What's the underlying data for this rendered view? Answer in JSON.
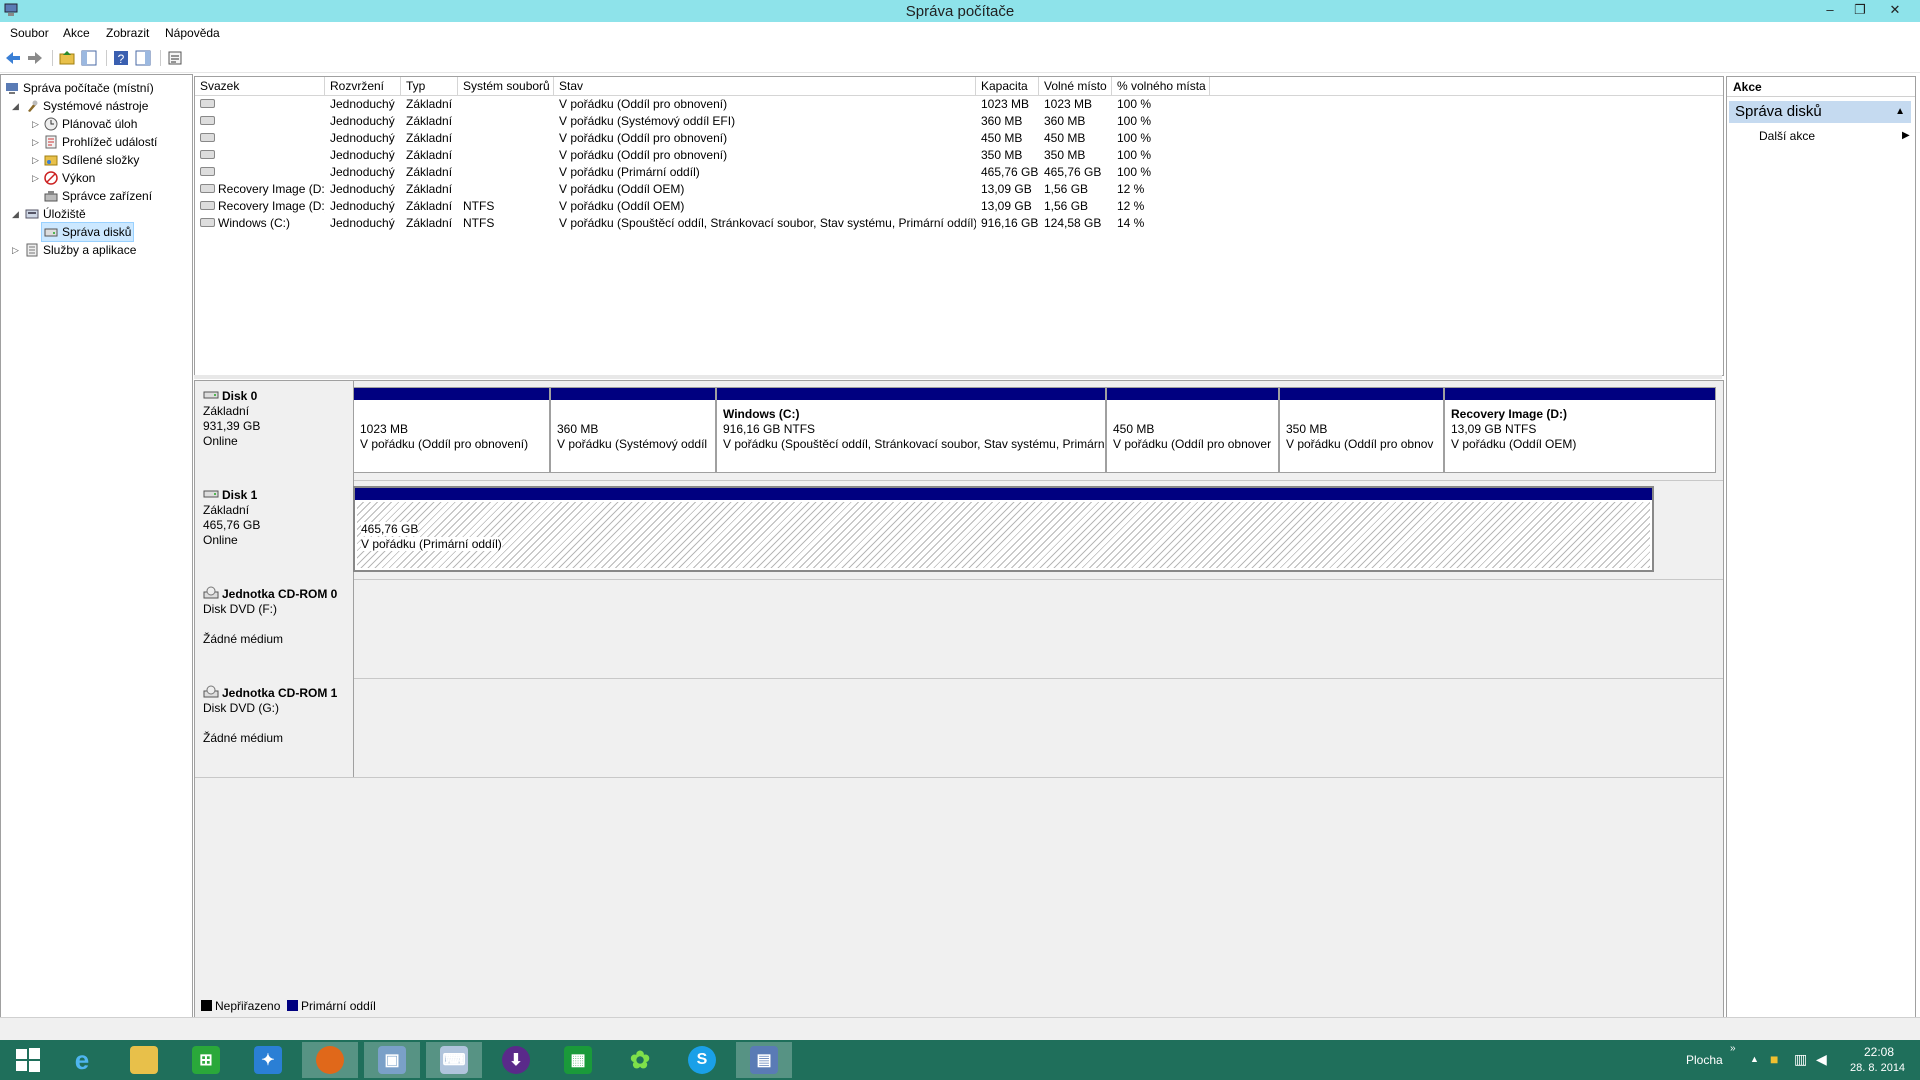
{
  "window": {
    "title": "Správa počítače",
    "minimize": "–",
    "restore": "❐",
    "close": "✕"
  },
  "menu": [
    "Soubor",
    "Akce",
    "Zobrazit",
    "Nápověda"
  ],
  "tree": {
    "root": "Správa počítače (místní)",
    "system_tools": "Systémové nástroje",
    "task_scheduler": "Plánovač úloh",
    "event_viewer": "Prohlížeč událostí",
    "shared_folders": "Sdílené složky",
    "performance": "Výkon",
    "device_manager": "Správce zařízení",
    "storage": "Úložiště",
    "disk_management": "Správa disků",
    "services": "Služby a aplikace"
  },
  "volumes": {
    "headers": [
      "Svazek",
      "Rozvržení",
      "Typ",
      "Systém souborů",
      "Stav",
      "Kapacita",
      "Volné místo",
      "% volného místa"
    ],
    "rows": [
      {
        "name": "",
        "layout": "Jednoduchý",
        "type": "Základní",
        "fs": "",
        "status": "V pořádku (Oddíl pro obnovení)",
        "capacity": "1023 MB",
        "free": "1023 MB",
        "pct": "100 %"
      },
      {
        "name": "",
        "layout": "Jednoduchý",
        "type": "Základní",
        "fs": "",
        "status": "V pořádku (Systémový oddíl EFI)",
        "capacity": "360 MB",
        "free": "360 MB",
        "pct": "100 %"
      },
      {
        "name": "",
        "layout": "Jednoduchý",
        "type": "Základní",
        "fs": "",
        "status": "V pořádku (Oddíl pro obnovení)",
        "capacity": "450 MB",
        "free": "450 MB",
        "pct": "100 %"
      },
      {
        "name": "",
        "layout": "Jednoduchý",
        "type": "Základní",
        "fs": "",
        "status": "V pořádku (Oddíl pro obnovení)",
        "capacity": "350 MB",
        "free": "350 MB",
        "pct": "100 %"
      },
      {
        "name": "",
        "layout": "Jednoduchý",
        "type": "Základní",
        "fs": "",
        "status": "V pořádku (Primární oddíl)",
        "capacity": "465,76 GB",
        "free": "465,76 GB",
        "pct": "100 %"
      },
      {
        "name": "Recovery Image (D:)",
        "layout": "Jednoduchý",
        "type": "Základní",
        "fs": "",
        "status": "V pořádku (Oddíl OEM)",
        "capacity": "13,09 GB",
        "free": "1,56 GB",
        "pct": "12 %"
      },
      {
        "name": "Recovery Image (D:)",
        "layout": "Jednoduchý",
        "type": "Základní",
        "fs": "NTFS",
        "status": "V pořádku (Oddíl OEM)",
        "capacity": "13,09 GB",
        "free": "1,56 GB",
        "pct": "12 %"
      },
      {
        "name": "Windows (C:)",
        "layout": "Jednoduchý",
        "type": "Základní",
        "fs": "NTFS",
        "status": "V pořádku (Spouštěcí oddíl, Stránkovací soubor, Stav systému, Primární oddíl)",
        "capacity": "916,16 GB",
        "free": "124,58 GB",
        "pct": "14 %"
      }
    ]
  },
  "disks": [
    {
      "name": "Disk 0",
      "type": "Základní",
      "size": "931,39 GB",
      "state": "Online",
      "partitions": [
        {
          "title": "",
          "size": "1023 MB",
          "status": "V pořádku (Oddíl pro obnovení)"
        },
        {
          "title": "",
          "size": "360 MB",
          "status": "V pořádku (Systémový oddíl"
        },
        {
          "title": "Windows  (C:)",
          "size": "916,16 GB NTFS",
          "status": "V pořádku (Spouštěcí oddíl, Stránkovací soubor, Stav systému, Primární"
        },
        {
          "title": "",
          "size": "450 MB",
          "status": "V pořádku (Oddíl pro obnover"
        },
        {
          "title": "",
          "size": "350 MB",
          "status": "V pořádku (Oddíl pro obnov"
        },
        {
          "title": "Recovery Image  (D:)",
          "size": "13,09 GB NTFS",
          "status": "V pořádku (Oddíl OEM)"
        }
      ]
    },
    {
      "name": "Disk 1",
      "type": "Základní",
      "size": "465,76 GB",
      "state": "Online",
      "partitions": [
        {
          "title": "",
          "size": "465,76 GB",
          "status": "V pořádku (Primární oddíl)"
        }
      ]
    },
    {
      "name": "Jednotka CD-ROM 0",
      "type": "Disk DVD (F:)",
      "size": "",
      "state": "Žádné médium"
    },
    {
      "name": "Jednotka CD-ROM 1",
      "type": "Disk DVD (G:)",
      "size": "",
      "state": "Žádné médium"
    }
  ],
  "legend": {
    "unallocated": "Nepřiřazeno",
    "primary": "Primární oddíl",
    "unallocated_color": "#000000",
    "primary_color": "#000080"
  },
  "actions": {
    "header": "Akce",
    "group": "Správa disků",
    "more": "Další akce"
  },
  "taskbar": {
    "desktop": "Plocha",
    "time": "22:08",
    "date": "28. 8. 2014"
  },
  "colors": {
    "titlebar": "#8ee3ea",
    "taskbar": "#1f6f5b",
    "partition_bar": "#000080"
  }
}
